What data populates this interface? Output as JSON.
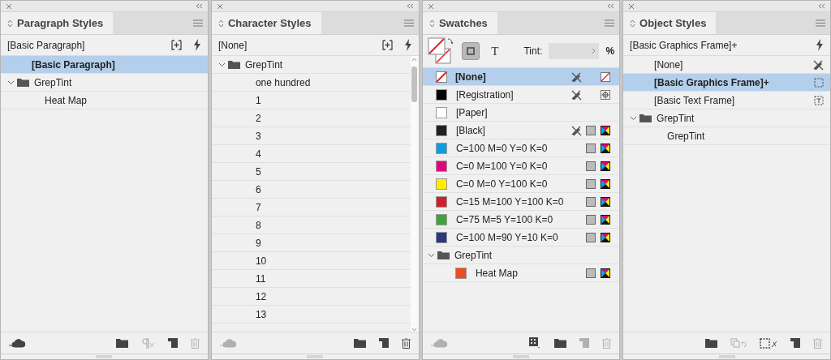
{
  "panels": [
    {
      "kind": "styles",
      "title": "Paragraph Styles",
      "current": "[Basic Paragraph]",
      "scrollable": false,
      "rows": [
        {
          "kind": "style",
          "label": "[Basic Paragraph]",
          "selected": true
        },
        {
          "kind": "folder",
          "label": "GrepTint",
          "expanded": true,
          "selected": false,
          "children": [
            {
              "kind": "style",
              "label": "Heat Map",
              "selected": false
            }
          ]
        }
      ],
      "footer": [
        {
          "disabled": false
        },
        {
          "disabled": false
        },
        {
          "disabled": true
        },
        {
          "disabled": false
        },
        {
          "disabled": true
        }
      ]
    },
    {
      "kind": "styles",
      "title": "Character Styles",
      "current": "[None]",
      "scrollable": true,
      "rows": [
        {
          "kind": "folder",
          "label": "GrepTint",
          "expanded": true,
          "selected": false,
          "children": [
            {
              "kind": "style",
              "label": "one hundred",
              "selected": false
            },
            {
              "kind": "style",
              "label": "1",
              "selected": false
            },
            {
              "kind": "style",
              "label": "2",
              "selected": false
            },
            {
              "kind": "style",
              "label": "3",
              "selected": false
            },
            {
              "kind": "style",
              "label": "4",
              "selected": false
            },
            {
              "kind": "style",
              "label": "5",
              "selected": false
            },
            {
              "kind": "style",
              "label": "6",
              "selected": false
            },
            {
              "kind": "style",
              "label": "7",
              "selected": false
            },
            {
              "kind": "style",
              "label": "8",
              "selected": false
            },
            {
              "kind": "style",
              "label": "9",
              "selected": false
            },
            {
              "kind": "style",
              "label": "10",
              "selected": false
            },
            {
              "kind": "style",
              "label": "11",
              "selected": false
            },
            {
              "kind": "style",
              "label": "12",
              "selected": false
            },
            {
              "kind": "style",
              "label": "13",
              "selected": false
            }
          ]
        }
      ],
      "footer": [
        {
          "disabled": true
        },
        {
          "disabled": false
        },
        {
          "disabled": false
        },
        {
          "disabled": false
        }
      ]
    },
    {
      "kind": "swatches",
      "title": "Swatches",
      "tint_label": "Tint:",
      "tint_unit": "%",
      "format_buttons": [
        {
          "kind": "container",
          "selected": true
        },
        {
          "kind": "text",
          "label": "T",
          "selected": false
        }
      ],
      "rows": [
        {
          "kind": "none",
          "label": "[None]",
          "selected": true,
          "locked": true
        },
        {
          "kind": "registration",
          "label": "[Registration]",
          "color": "#000000",
          "selected": false,
          "locked": true
        },
        {
          "kind": "paper",
          "label": "[Paper]",
          "color": "#ffffff",
          "selected": false,
          "locked": false
        },
        {
          "kind": "process",
          "label": "[Black]",
          "color": "#231f20",
          "selected": false,
          "locked": true
        },
        {
          "kind": "process",
          "label": "C=100 M=0 Y=0 K=0",
          "color": "#0e9ee0",
          "selected": false,
          "locked": false
        },
        {
          "kind": "process",
          "label": "C=0 M=100 Y=0 K=0",
          "color": "#e5007e",
          "selected": false,
          "locked": false
        },
        {
          "kind": "process",
          "label": "C=0 M=0 Y=100 K=0",
          "color": "#ffec00",
          "selected": false,
          "locked": false
        },
        {
          "kind": "process",
          "label": "C=15 M=100 Y=100 K=0",
          "color": "#d11f27",
          "selected": false,
          "locked": false
        },
        {
          "kind": "process",
          "label": "C=75 M=5 Y=100 K=0",
          "color": "#3ea33a",
          "selected": false,
          "locked": false
        },
        {
          "kind": "process",
          "label": "C=100 M=90 Y=10 K=0",
          "color": "#29387f",
          "selected": false,
          "locked": false
        },
        {
          "kind": "folder",
          "label": "GrepTint",
          "expanded": true,
          "selected": false,
          "children": [
            {
              "kind": "process",
              "label": "Heat Map",
              "color": "#e64e25",
              "selected": false,
              "locked": false
            }
          ]
        }
      ],
      "footer": [
        {
          "disabled": true
        },
        {
          "disabled": false
        },
        {
          "disabled": false
        },
        {
          "disabled": true
        },
        {
          "disabled": true
        }
      ]
    },
    {
      "kind": "styles",
      "title": "Object Styles",
      "current": "[Basic Graphics Frame]+",
      "scrollable": false,
      "rows": [
        {
          "kind": "none",
          "label": "[None]",
          "selected": false
        },
        {
          "kind": "graphics",
          "label": "[Basic Graphics Frame]+",
          "selected": true
        },
        {
          "kind": "text",
          "label": "[Basic Text Frame]",
          "selected": false
        },
        {
          "kind": "folder",
          "label": "GrepTint",
          "expanded": true,
          "selected": false,
          "children": [
            {
              "kind": "style",
              "label": "GrepTint",
              "selected": false
            }
          ]
        }
      ],
      "footer": [
        {
          "disabled": false
        },
        {
          "disabled": true
        },
        {
          "disabled": false
        },
        {
          "disabled": false
        },
        {
          "disabled": true
        }
      ]
    }
  ]
}
